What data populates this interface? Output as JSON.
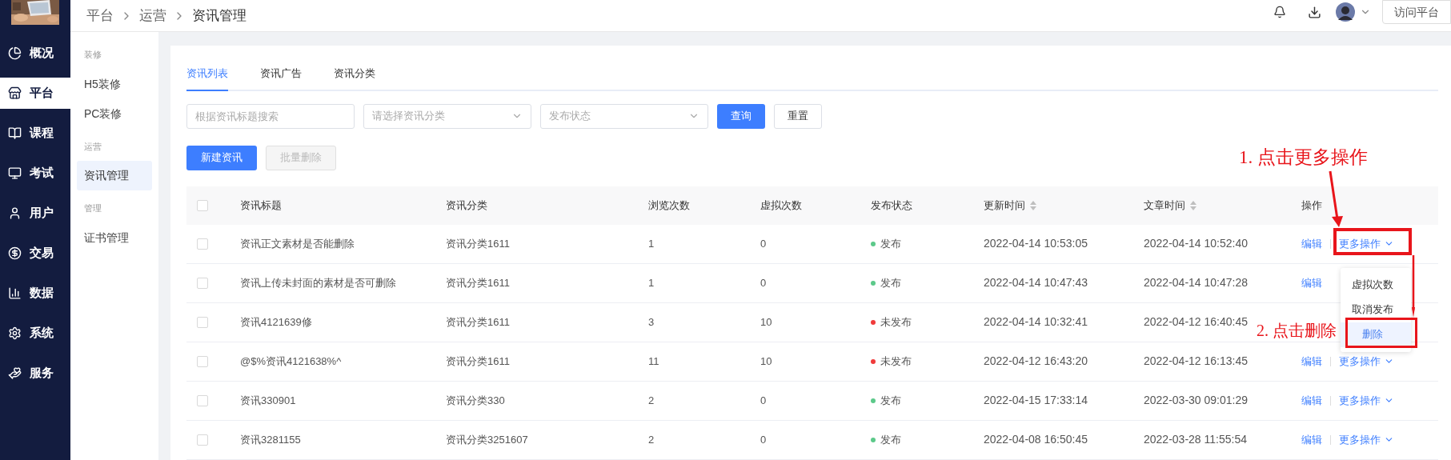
{
  "sidebar": {
    "items": [
      {
        "label": "概况",
        "selected": false
      },
      {
        "label": "平台",
        "selected": true
      },
      {
        "label": "课程",
        "selected": false
      },
      {
        "label": "考试",
        "selected": false
      },
      {
        "label": "用户",
        "selected": false
      },
      {
        "label": "交易",
        "selected": false
      },
      {
        "label": "数据",
        "selected": false
      },
      {
        "label": "系统",
        "selected": false
      },
      {
        "label": "服务",
        "selected": false
      }
    ]
  },
  "breadcrumb": [
    "平台",
    "运营",
    "资讯管理"
  ],
  "header": {
    "visit_button": "访问平台"
  },
  "subnav": {
    "groups": [
      {
        "heading": "装修",
        "items": [
          {
            "label": "H5装修",
            "selected": false
          },
          {
            "label": "PC装修",
            "selected": false
          }
        ]
      },
      {
        "heading": "运营",
        "items": [
          {
            "label": "资讯管理",
            "selected": true
          }
        ]
      },
      {
        "heading": "管理",
        "items": [
          {
            "label": "证书管理",
            "selected": false
          }
        ]
      }
    ]
  },
  "tabs": [
    {
      "label": "资讯列表",
      "selected": true
    },
    {
      "label": "资讯广告",
      "selected": false
    },
    {
      "label": "资讯分类",
      "selected": false
    }
  ],
  "filters": {
    "search": {
      "placeholder": "根据资讯标题搜索"
    },
    "category": {
      "placeholder": "请选择资讯分类"
    },
    "status": {
      "placeholder": "发布状态"
    },
    "query_button": "查询",
    "reset_button": "重置"
  },
  "actions": {
    "create": "新建资讯",
    "batch_delete": {
      "label": "批量删除",
      "disabled": true
    }
  },
  "table": {
    "select_all_checked": false,
    "columns": [
      {
        "label": "资讯标题",
        "sortable": false
      },
      {
        "label": "资讯分类",
        "sortable": false
      },
      {
        "label": "浏览次数",
        "sortable": false
      },
      {
        "label": "虚拟次数",
        "sortable": false
      },
      {
        "label": "发布状态",
        "sortable": false
      },
      {
        "label": "更新时间",
        "sortable": true
      },
      {
        "label": "文章时间",
        "sortable": true
      },
      {
        "label": "操作",
        "sortable": false
      }
    ],
    "rows": [
      {
        "checked": false,
        "title": "资讯正文素材是否能删除",
        "category": "资讯分类1611",
        "views": "1",
        "virtual": "0",
        "status": {
          "label": "发布",
          "color": "#5cc98a"
        },
        "updated": "2022-04-14 10:53:05",
        "article_time": "2022-04-14 10:52:40",
        "edit": "编辑",
        "more": "更多操作"
      },
      {
        "checked": false,
        "title": "资讯上传未封面的素材是否可删除",
        "category": "资讯分类1611",
        "views": "1",
        "virtual": "0",
        "status": {
          "label": "发布",
          "color": "#5cc98a"
        },
        "updated": "2022-04-14 10:47:43",
        "article_time": "2022-04-14 10:47:28",
        "edit": "编辑"
      },
      {
        "checked": false,
        "title": "资讯4121639修",
        "category": "资讯分类1611",
        "views": "3",
        "virtual": "10",
        "status": {
          "label": "未发布",
          "color": "#f03a3a"
        },
        "updated": "2022-04-14 10:32:41",
        "article_time": "2022-04-12 16:40:45"
      },
      {
        "checked": false,
        "title": "@$%资讯4121638%^",
        "category": "资讯分类1611",
        "views": "11",
        "virtual": "10",
        "status": {
          "label": "未发布",
          "color": "#f03a3a"
        },
        "updated": "2022-04-12 16:43:20",
        "article_time": "2022-04-12 16:13:45",
        "edit": "编辑",
        "more": "更多操作"
      },
      {
        "checked": false,
        "title": "资讯330901",
        "category": "资讯分类330",
        "views": "2",
        "virtual": "0",
        "status": {
          "label": "发布",
          "color": "#5cc98a"
        },
        "updated": "2022-04-15 17:33:14",
        "article_time": "2022-03-30 09:01:29",
        "edit": "编辑",
        "more": "更多操作"
      },
      {
        "checked": false,
        "title": "资讯3281155",
        "category": "资讯分类3251607",
        "views": "2",
        "virtual": "0",
        "status": {
          "label": "发布",
          "color": "#5cc98a"
        },
        "updated": "2022-04-08 16:50:45",
        "article_time": "2022-03-28 11:55:54",
        "edit": "编辑",
        "more": "更多操作"
      }
    ]
  },
  "dropdown": {
    "items": [
      {
        "label": "虚拟次数",
        "selected": false
      },
      {
        "label": "取消发布",
        "selected": false
      },
      {
        "label": "删除",
        "selected": true
      }
    ]
  },
  "annotations": [
    {
      "text": "1. 点击更多操作"
    },
    {
      "text": "2. 点击删除"
    }
  ]
}
